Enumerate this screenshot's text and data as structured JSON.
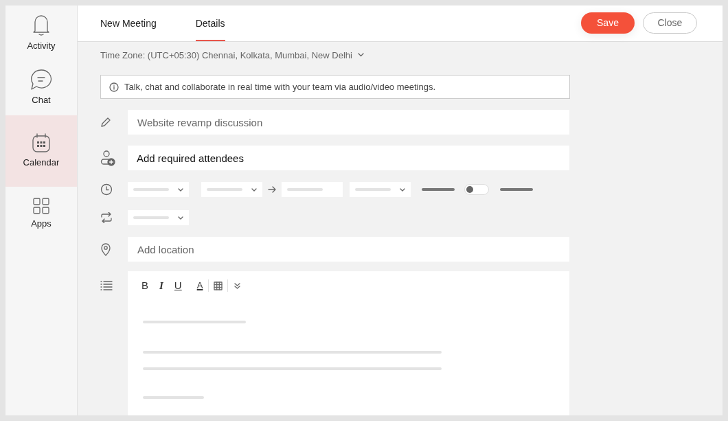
{
  "sidebar": {
    "items": [
      {
        "label": "Activity",
        "selected": false
      },
      {
        "label": "Chat",
        "selected": false
      },
      {
        "label": "Calendar",
        "selected": true
      },
      {
        "label": "Apps",
        "selected": false
      }
    ]
  },
  "tabs": [
    {
      "label": "New Meeting",
      "selected": false
    },
    {
      "label": "Details",
      "selected": true
    }
  ],
  "buttons": {
    "save": "Save",
    "close": "Close"
  },
  "time_zone": "Time Zone: (UTC+05:30) Chennai, Kolkata, Mumbai, New Delhi",
  "info_banner": "Talk, chat and collaborate in real time with your team via audio/video meetings.",
  "title_field": {
    "placeholder": "Website revamp discussion"
  },
  "attendees_field": {
    "value": "Add required attendees"
  },
  "all_day_toggle": {
    "on": false
  },
  "location_field": {
    "placeholder": "Add location"
  },
  "editor_toolbar": [
    "B",
    "I",
    "U",
    "A"
  ]
}
